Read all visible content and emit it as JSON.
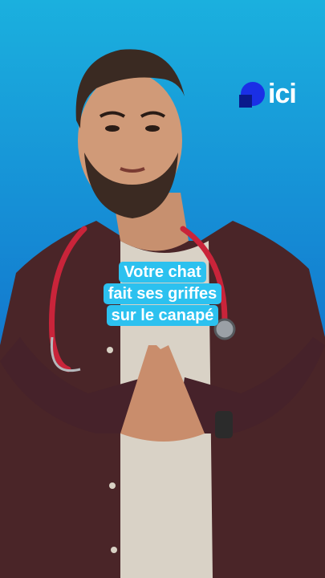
{
  "brand": {
    "name": "ici",
    "color": "#1a2fe6"
  },
  "caption": {
    "lines": [
      "Votre chat",
      "fait ses griffes",
      "sur le canapé"
    ],
    "highlight_color": "#2cc1ef"
  },
  "scene": {
    "subject": "person-icon",
    "accessory": "stethoscope-icon"
  }
}
